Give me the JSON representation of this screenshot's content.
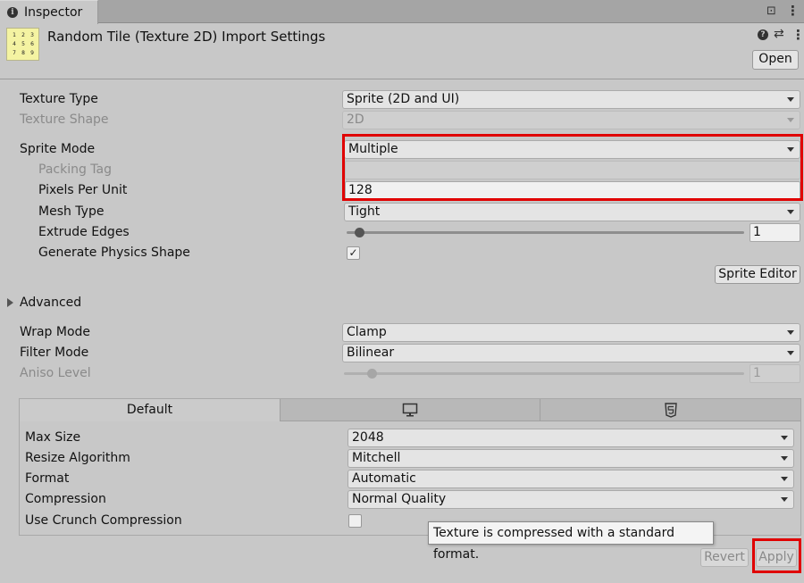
{
  "window": {
    "tab_label": "Inspector",
    "info_glyph": "i",
    "lock_glyph": "⊡",
    "menu_glyph": "⋮"
  },
  "header": {
    "thumbnail_digits": [
      "1",
      "2",
      "3",
      "4",
      "5",
      "6",
      "7",
      "8",
      "9"
    ],
    "title": "Random Tile (Texture 2D) Import Settings",
    "help_glyph": "?",
    "preset_glyph": "⇄",
    "menu_glyph": "⋮",
    "open_label": "Open"
  },
  "settings": {
    "texture_type": {
      "label": "Texture Type",
      "value": "Sprite (2D and UI)"
    },
    "texture_shape": {
      "label": "Texture Shape",
      "value": "2D"
    },
    "sprite_mode": {
      "label": "Sprite Mode",
      "value": "Multiple"
    },
    "packing_tag": {
      "label": "Packing Tag",
      "value": ""
    },
    "pixels_per_unit": {
      "label": "Pixels Per Unit",
      "value": "128"
    },
    "mesh_type": {
      "label": "Mesh Type",
      "value": "Tight"
    },
    "extrude_edges": {
      "label": "Extrude Edges",
      "value": "1",
      "slider_fraction": 0.031
    },
    "generate_physics_shape": {
      "label": "Generate Physics Shape",
      "checked": true,
      "check_glyph": "✓"
    },
    "sprite_editor_label": "Sprite Editor",
    "advanced_label": "Advanced",
    "wrap_mode": {
      "label": "Wrap Mode",
      "value": "Clamp"
    },
    "filter_mode": {
      "label": "Filter Mode",
      "value": "Bilinear"
    },
    "aniso_level": {
      "label": "Aniso Level",
      "value": "1",
      "slider_fraction": 0.07
    }
  },
  "platform": {
    "tabs": [
      {
        "label": "Default",
        "icon": ""
      },
      {
        "label": "",
        "icon": "monitor-icon"
      },
      {
        "label": "",
        "icon": "html5-icon"
      }
    ],
    "max_size": {
      "label": "Max Size",
      "value": "2048"
    },
    "resize_algorithm": {
      "label": "Resize Algorithm",
      "value": "Mitchell"
    },
    "format": {
      "label": "Format",
      "value": "Automatic"
    },
    "compression": {
      "label": "Compression",
      "value": "Normal Quality"
    },
    "use_crunch": {
      "label": "Use Crunch Compression",
      "checked": false
    }
  },
  "tooltip": "Texture is compressed with a standard format.",
  "footer": {
    "revert_label": "Revert",
    "apply_label": "Apply"
  },
  "colors": {
    "highlight": "#e00000",
    "thumbnail_bg": "#f4f3a2",
    "panel_bg": "#c8c8c8"
  }
}
